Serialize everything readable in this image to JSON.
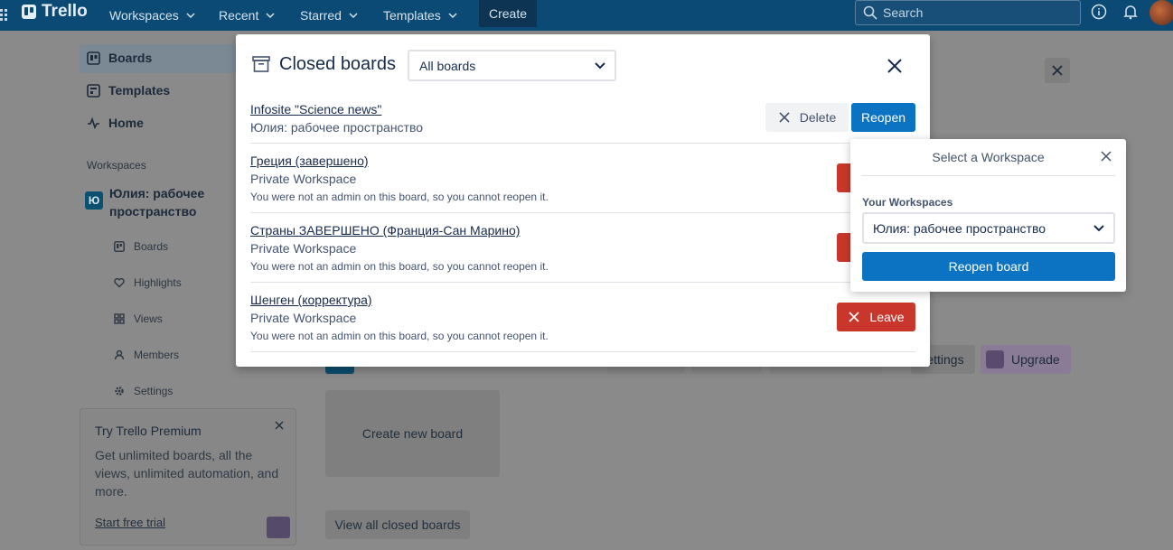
{
  "topnav": {
    "brand": "Trello",
    "items": [
      "Workspaces",
      "Recent",
      "Starred",
      "Templates"
    ],
    "create_label": "Create",
    "search_placeholder": "Search"
  },
  "sidebar": {
    "main_items": [
      "Boards",
      "Templates",
      "Home"
    ],
    "section_label": "Workspaces",
    "workspace_initial": "Ю",
    "workspace_name": "Юлия: рабочее пространство",
    "workspace_items": [
      "Boards",
      "Highlights",
      "Views",
      "Members",
      "Settings"
    ],
    "premium": {
      "title": "Try Trello Premium",
      "text": "Get unlimited boards, all the views, unlimited automation, and more.",
      "link": "Start free trial"
    }
  },
  "background": {
    "settings_label": "Settings",
    "upgrade_label": "Upgrade",
    "create_board_label": "Create new board",
    "view_closed_label": "View all closed boards"
  },
  "modal": {
    "title": "Closed boards",
    "filter_value": "All boards",
    "rows": [
      {
        "name": "Infosite \"Science news\"",
        "workspace": "Юлия: рабочее пространство",
        "note": ""
      },
      {
        "name": "Греция (завершено)",
        "workspace": "Private Workspace",
        "note": "You were not an admin on this board, so you cannot reopen it."
      },
      {
        "name": "Страны ЗАВЕРШЕНО (Франция-Сан Марино)",
        "workspace": "Private Workspace",
        "note": "You were not an admin on this board, so you cannot reopen it."
      },
      {
        "name": "Шенген (корректура)",
        "workspace": "Private Workspace",
        "note": "You were not an admin on this board, so you cannot reopen it."
      }
    ],
    "delete_label": "Delete",
    "reopen_label": "Reopen",
    "leave_label": "Leave"
  },
  "popover": {
    "title": "Select a Workspace",
    "label": "Your Workspaces",
    "selected": "Юлия: рабочее пространство",
    "button": "Reopen board"
  },
  "colors": {
    "nav": "#0a4a75",
    "primary": "#0c73c2",
    "danger": "#c9372c"
  }
}
